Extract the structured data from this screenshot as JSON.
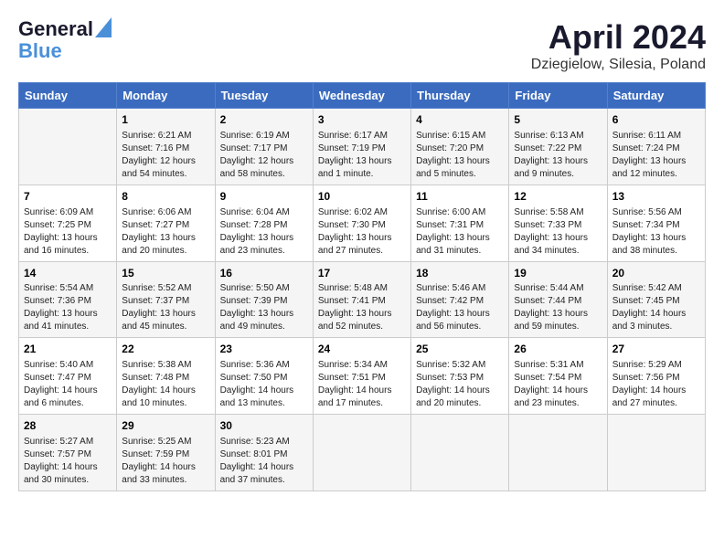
{
  "header": {
    "logo_line1": "General",
    "logo_line2": "Blue",
    "month": "April 2024",
    "location": "Dziegielow, Silesia, Poland"
  },
  "columns": [
    "Sunday",
    "Monday",
    "Tuesday",
    "Wednesday",
    "Thursday",
    "Friday",
    "Saturday"
  ],
  "weeks": [
    [
      {
        "day": "",
        "info": ""
      },
      {
        "day": "1",
        "info": "Sunrise: 6:21 AM\nSunset: 7:16 PM\nDaylight: 12 hours\nand 54 minutes."
      },
      {
        "day": "2",
        "info": "Sunrise: 6:19 AM\nSunset: 7:17 PM\nDaylight: 12 hours\nand 58 minutes."
      },
      {
        "day": "3",
        "info": "Sunrise: 6:17 AM\nSunset: 7:19 PM\nDaylight: 13 hours\nand 1 minute."
      },
      {
        "day": "4",
        "info": "Sunrise: 6:15 AM\nSunset: 7:20 PM\nDaylight: 13 hours\nand 5 minutes."
      },
      {
        "day": "5",
        "info": "Sunrise: 6:13 AM\nSunset: 7:22 PM\nDaylight: 13 hours\nand 9 minutes."
      },
      {
        "day": "6",
        "info": "Sunrise: 6:11 AM\nSunset: 7:24 PM\nDaylight: 13 hours\nand 12 minutes."
      }
    ],
    [
      {
        "day": "7",
        "info": "Sunrise: 6:09 AM\nSunset: 7:25 PM\nDaylight: 13 hours\nand 16 minutes."
      },
      {
        "day": "8",
        "info": "Sunrise: 6:06 AM\nSunset: 7:27 PM\nDaylight: 13 hours\nand 20 minutes."
      },
      {
        "day": "9",
        "info": "Sunrise: 6:04 AM\nSunset: 7:28 PM\nDaylight: 13 hours\nand 23 minutes."
      },
      {
        "day": "10",
        "info": "Sunrise: 6:02 AM\nSunset: 7:30 PM\nDaylight: 13 hours\nand 27 minutes."
      },
      {
        "day": "11",
        "info": "Sunrise: 6:00 AM\nSunset: 7:31 PM\nDaylight: 13 hours\nand 31 minutes."
      },
      {
        "day": "12",
        "info": "Sunrise: 5:58 AM\nSunset: 7:33 PM\nDaylight: 13 hours\nand 34 minutes."
      },
      {
        "day": "13",
        "info": "Sunrise: 5:56 AM\nSunset: 7:34 PM\nDaylight: 13 hours\nand 38 minutes."
      }
    ],
    [
      {
        "day": "14",
        "info": "Sunrise: 5:54 AM\nSunset: 7:36 PM\nDaylight: 13 hours\nand 41 minutes."
      },
      {
        "day": "15",
        "info": "Sunrise: 5:52 AM\nSunset: 7:37 PM\nDaylight: 13 hours\nand 45 minutes."
      },
      {
        "day": "16",
        "info": "Sunrise: 5:50 AM\nSunset: 7:39 PM\nDaylight: 13 hours\nand 49 minutes."
      },
      {
        "day": "17",
        "info": "Sunrise: 5:48 AM\nSunset: 7:41 PM\nDaylight: 13 hours\nand 52 minutes."
      },
      {
        "day": "18",
        "info": "Sunrise: 5:46 AM\nSunset: 7:42 PM\nDaylight: 13 hours\nand 56 minutes."
      },
      {
        "day": "19",
        "info": "Sunrise: 5:44 AM\nSunset: 7:44 PM\nDaylight: 13 hours\nand 59 minutes."
      },
      {
        "day": "20",
        "info": "Sunrise: 5:42 AM\nSunset: 7:45 PM\nDaylight: 14 hours\nand 3 minutes."
      }
    ],
    [
      {
        "day": "21",
        "info": "Sunrise: 5:40 AM\nSunset: 7:47 PM\nDaylight: 14 hours\nand 6 minutes."
      },
      {
        "day": "22",
        "info": "Sunrise: 5:38 AM\nSunset: 7:48 PM\nDaylight: 14 hours\nand 10 minutes."
      },
      {
        "day": "23",
        "info": "Sunrise: 5:36 AM\nSunset: 7:50 PM\nDaylight: 14 hours\nand 13 minutes."
      },
      {
        "day": "24",
        "info": "Sunrise: 5:34 AM\nSunset: 7:51 PM\nDaylight: 14 hours\nand 17 minutes."
      },
      {
        "day": "25",
        "info": "Sunrise: 5:32 AM\nSunset: 7:53 PM\nDaylight: 14 hours\nand 20 minutes."
      },
      {
        "day": "26",
        "info": "Sunrise: 5:31 AM\nSunset: 7:54 PM\nDaylight: 14 hours\nand 23 minutes."
      },
      {
        "day": "27",
        "info": "Sunrise: 5:29 AM\nSunset: 7:56 PM\nDaylight: 14 hours\nand 27 minutes."
      }
    ],
    [
      {
        "day": "28",
        "info": "Sunrise: 5:27 AM\nSunset: 7:57 PM\nDaylight: 14 hours\nand 30 minutes."
      },
      {
        "day": "29",
        "info": "Sunrise: 5:25 AM\nSunset: 7:59 PM\nDaylight: 14 hours\nand 33 minutes."
      },
      {
        "day": "30",
        "info": "Sunrise: 5:23 AM\nSunset: 8:01 PM\nDaylight: 14 hours\nand 37 minutes."
      },
      {
        "day": "",
        "info": ""
      },
      {
        "day": "",
        "info": ""
      },
      {
        "day": "",
        "info": ""
      },
      {
        "day": "",
        "info": ""
      }
    ]
  ]
}
